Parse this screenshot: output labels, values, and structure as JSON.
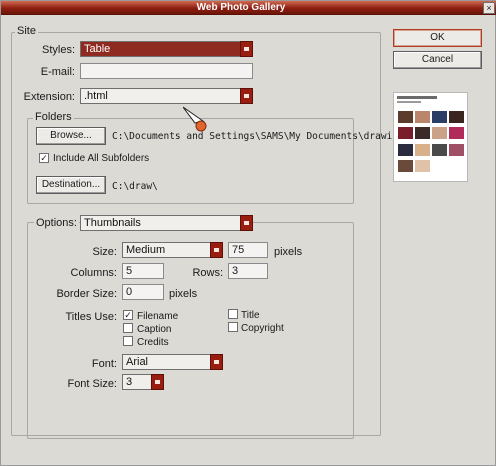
{
  "window": {
    "title": "Web Photo Gallery",
    "close_glyph": "×"
  },
  "site": {
    "legend": "Site",
    "styles_label": "Styles:",
    "styles_value": "Table",
    "email_label": "E-mail:",
    "email_value": "",
    "extension_label": "Extension:",
    "extension_value": ".html"
  },
  "folders": {
    "legend": "Folders",
    "browse_label": "Browse...",
    "source_path": "C:\\Documents and Settings\\SAMS\\My Documents\\drawings\\",
    "include_subfolders_label": "Include All Subfolders",
    "include_subfolders_checked": true,
    "destination_label": "Destination...",
    "destination_path": "C:\\draw\\"
  },
  "options": {
    "label": "Options:",
    "value": "Thumbnails",
    "size_label": "Size:",
    "size_value": "Medium",
    "size_pixels_value": "75",
    "pixels_label": "pixels",
    "columns_label": "Columns:",
    "columns_value": "5",
    "rows_label": "Rows:",
    "rows_value": "3",
    "border_label": "Border Size:",
    "border_value": "0",
    "border_pixels_label": "pixels",
    "titles_use_label": "Titles Use:",
    "titles_filename_label": "Filename",
    "titles_filename_checked": true,
    "titles_caption_label": "Caption",
    "titles_caption_checked": false,
    "titles_credits_label": "Credits",
    "titles_credits_checked": false,
    "titles_title_label": "Title",
    "titles_title_checked": false,
    "titles_copyright_label": "Copyright",
    "titles_copyright_checked": false,
    "font_label": "Font:",
    "font_value": "Arial",
    "font_size_label": "Font Size:",
    "font_size_value": "3"
  },
  "buttons": {
    "ok_label": "OK",
    "cancel_label": "Cancel"
  },
  "colors": {
    "accent": "#8f2a20",
    "title_bar": "#8e1f12",
    "dialog_bg": "#dcdad5"
  }
}
